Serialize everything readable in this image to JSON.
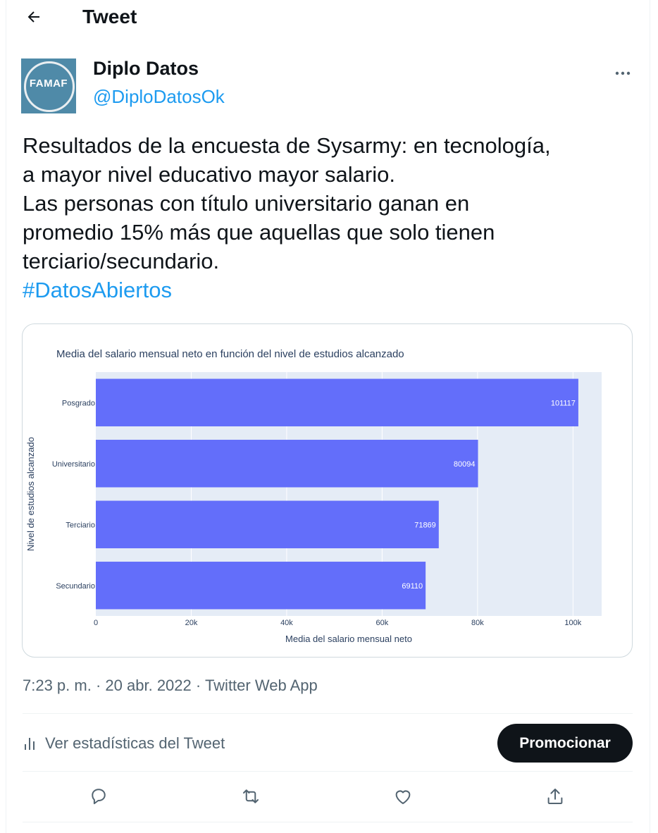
{
  "header": {
    "title": "Tweet",
    "back_icon": "arrow-left-icon"
  },
  "author": {
    "display_name": "Diplo Datos",
    "handle": "@DiploDatosOk",
    "avatar_text": "FAMAF",
    "avatar_color": "#4f8aa8"
  },
  "tweet": {
    "lines": [
      "Resultados de la encuesta de Sysarmy: en tecnología,",
      "a mayor nivel educativo mayor salario.",
      "Las personas con título universitario ganan en",
      "promedio 15% más que aquellas que solo tienen",
      "terciario/secundario."
    ],
    "hashtag": "#DatosAbiertos"
  },
  "chart_data": {
    "type": "bar",
    "orientation": "horizontal",
    "title": "Media del salario mensual neto en función del nivel de estudios alcanzado",
    "xlabel": "Media del salario mensual neto",
    "ylabel": "Nivel de estudios alcanzado",
    "categories": [
      "Posgrado",
      "Universitario",
      "Terciario",
      "Secundario"
    ],
    "values": [
      101117,
      80094,
      71869,
      69110
    ],
    "data_labels": [
      "101117",
      "80094",
      "71869",
      "69110"
    ],
    "xlim": [
      0,
      106000
    ],
    "x_ticks": [
      0,
      20000,
      40000,
      60000,
      80000,
      100000
    ],
    "x_tick_labels": [
      "0",
      "20k",
      "40k",
      "60k",
      "80k",
      "100k"
    ],
    "bar_color": "#636efa",
    "plot_background": "#e5ecf6",
    "grid": true
  },
  "meta": {
    "time": "7:23 p. m.",
    "date": "20 abr. 2022",
    "source": "Twitter Web App",
    "separator": "·"
  },
  "stats": {
    "label": "Ver estadísticas del Tweet",
    "icon": "bar-chart-icon"
  },
  "promote": {
    "label": "Promocionar"
  },
  "actions": [
    {
      "name": "reply",
      "icon": "reply-icon"
    },
    {
      "name": "retweet",
      "icon": "retweet-icon"
    },
    {
      "name": "like",
      "icon": "heart-icon"
    },
    {
      "name": "share",
      "icon": "share-icon"
    }
  ],
  "colors": {
    "accent": "#1d9bf0",
    "text": "#0f1419",
    "secondary": "#536471",
    "border": "#cfd9de"
  }
}
